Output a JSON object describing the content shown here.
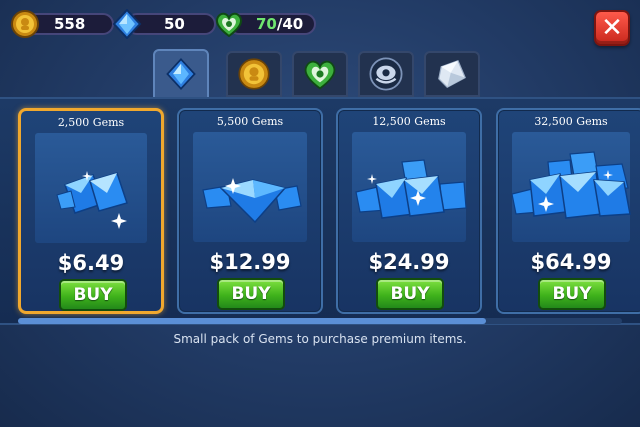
{
  "resources": {
    "coins": {
      "value": "558",
      "icon": "gold-coin-icon"
    },
    "gems": {
      "value": "50",
      "icon": "blue-gem-icon"
    },
    "energy": {
      "current": "70",
      "max": "/40",
      "icon": "green-heart-icon"
    }
  },
  "close": {
    "label": "✕",
    "icon": "close-icon"
  },
  "tabs": [
    {
      "id": "gems",
      "icon": "blue-gem-icon",
      "active": true
    },
    {
      "id": "coins",
      "icon": "gold-coin-icon",
      "active": false
    },
    {
      "id": "energy",
      "icon": "green-heart-icon",
      "active": false
    },
    {
      "id": "pets",
      "icon": "monster-icon",
      "active": false
    },
    {
      "id": "crystal",
      "icon": "crystal-block-icon",
      "active": false
    }
  ],
  "offers": [
    {
      "amount": "2,500 Gems",
      "price": "$6.49",
      "buy_label": "BUY",
      "selected": true
    },
    {
      "amount": "5,500 Gems",
      "price": "$12.99",
      "buy_label": "BUY",
      "selected": false
    },
    {
      "amount": "12,500 Gems",
      "price": "$24.99",
      "buy_label": "BUY",
      "selected": false
    },
    {
      "amount": "32,500 Gems",
      "price": "$64.99",
      "buy_label": "BUY",
      "selected": false
    }
  ],
  "description": "Small pack of Gems to purchase premium items.",
  "colors": {
    "accent_selected": "#f0a82e",
    "buy_green": "#3fb21b",
    "energy_green": "#6fe56f",
    "close_red": "#e0392c"
  }
}
